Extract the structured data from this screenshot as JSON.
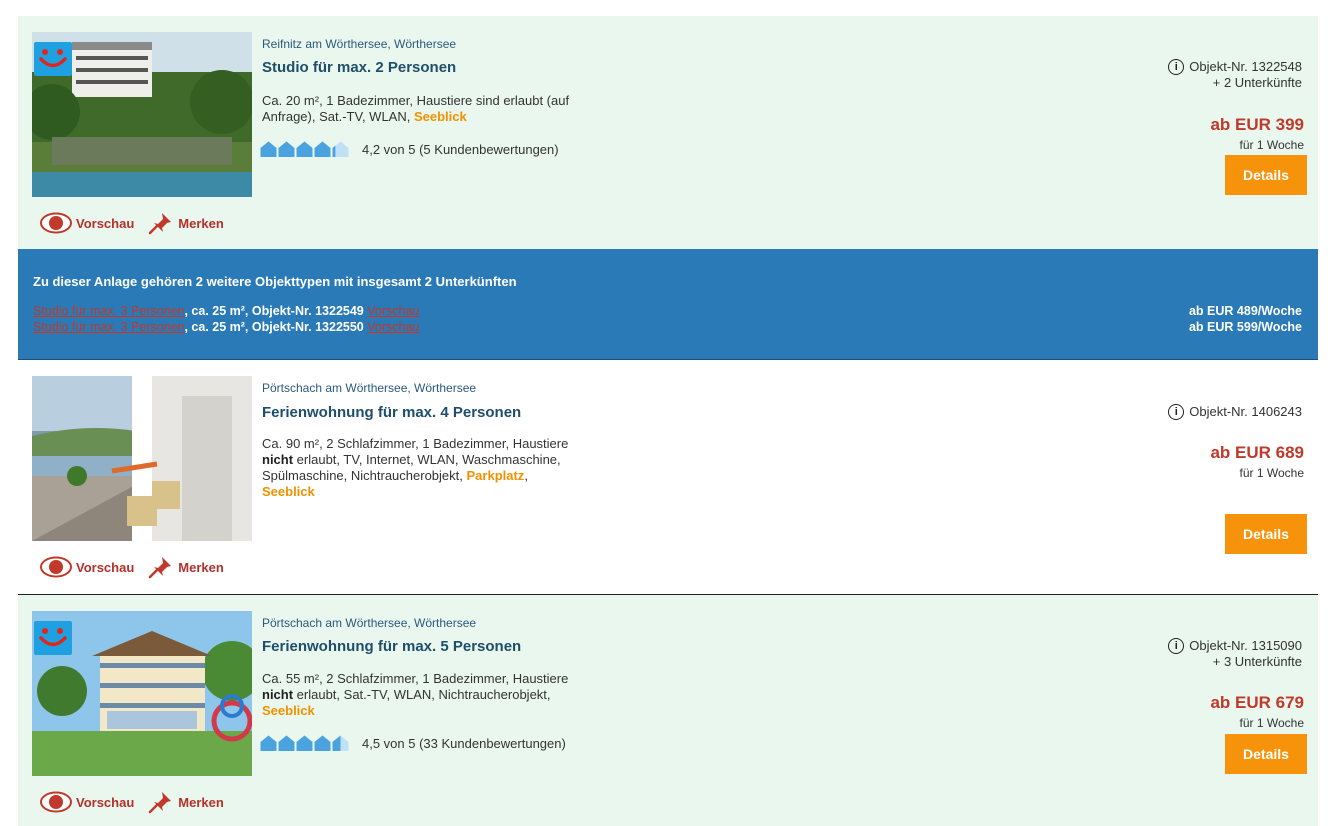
{
  "listings": [
    {
      "location": "Reifnitz am Wörthersee, Wörthersee",
      "title": "Studio für max. 2 Personen",
      "desc_plain": "Ca. 20 m², 1 Badezimmer, Haustiere sind erlaubt (auf Anfrage), Sat.-TV, WLAN, ",
      "desc_highlight": "Seeblick",
      "rating_text": "4,2 von 5 (5 Kundenbewertungen)",
      "rating_value": 4.2,
      "object_nr": "Objekt-Nr. 1322548",
      "extra_units": "+ 2 Unterkünfte",
      "price": "ab EUR 399",
      "per": "für 1 Woche",
      "details": "Details",
      "preview": "Vorschau",
      "save": "Merken"
    },
    {
      "location": "Pörtschach am Wörthersee, Wörthersee",
      "title": "Ferienwohnung für max. 4 Personen",
      "desc_1": "Ca. 90 m², 2 Schlafzimmer, 1 Badezimmer, Haustiere",
      "desc_2_bold": "nicht",
      "desc_2_rest": " erlaubt, TV, Internet, WLAN, Waschmaschine,",
      "desc_3": "Spülmaschine, Nichtraucherobjekt, ",
      "desc_3_highlight": "Parkplatz",
      "desc_3_tail": ",",
      "desc_4_highlight": "Seeblick",
      "object_nr": "Objekt-Nr. 1406243",
      "price": "ab EUR 689",
      "per": "für 1 Woche",
      "details": "Details",
      "preview": "Vorschau",
      "save": "Merken"
    },
    {
      "location": "Pörtschach am Wörthersee, Wörthersee",
      "title": "Ferienwohnung für max. 5 Personen",
      "desc_1": "Ca. 55 m², 2 Schlafzimmer, 1 Badezimmer, Haustiere",
      "desc_2_bold": "nicht",
      "desc_2_rest": " erlaubt, Sat.-TV, WLAN, Nichtraucherobjekt,",
      "desc_3_highlight": "Seeblick",
      "rating_text": "4,5 von 5 (33 Kundenbewertungen)",
      "rating_value": 4.5,
      "object_nr": "Objekt-Nr. 1315090",
      "extra_units": "+ 3 Unterkünfte",
      "price": "ab EUR 679",
      "per": "für 1 Woche",
      "details": "Details",
      "preview": "Vorschau",
      "save": "Merken"
    }
  ],
  "banner": {
    "heading": "Zu dieser Anlage gehören 2 weitere Objekttypen mit insgesamt 2 Unterkünften",
    "rows": [
      {
        "link": "Studio für max. 3 Personen",
        "info": ", ca. 25 m², Objekt-Nr. 1322549 ",
        "preview": "Vorschau",
        "price": "ab EUR 489/Woche"
      },
      {
        "link": "Studio für max. 3 Personen",
        "info": ", ca. 25 m², Objekt-Nr. 1322550 ",
        "preview": "Vorschau",
        "price": "ab EUR 599/Woche"
      }
    ]
  },
  "icons": {
    "brand": "tui-logo",
    "rating": "house-icon",
    "preview": "eye-icon",
    "save": "pin-icon",
    "info": "info-icon"
  },
  "colors": {
    "card_green": "#e9f7ee",
    "banner_blue": "#2a7ab8",
    "price_red": "#c0392b",
    "highlight_orange": "#f29100",
    "button_orange": "#f7930a",
    "title_blue": "#1f4e6b"
  }
}
